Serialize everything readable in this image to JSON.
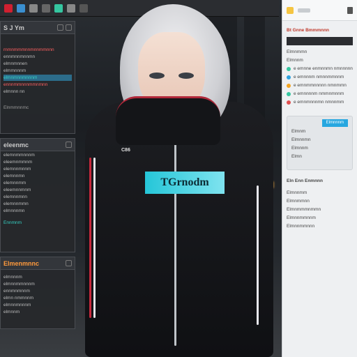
{
  "topbar": {
    "icons": [
      "app-icon",
      "file-icon",
      "edit-icon",
      "view-icon",
      "layer-icon",
      "brush-icon",
      "settings-icon"
    ]
  },
  "left_panels": {
    "p1": {
      "title": "S J Ym",
      "rows": [
        "rnmnmmmnnmnnmmnnn",
        "ennmnnmnnmn",
        "elmnmnnen",
        "elmmnnnm",
        "elmnmnnmnnnm",
        "ennnmmnnnmmnmnn",
        "elmnnn nn"
      ],
      "footer": "Elnmmnnmc"
    },
    "p2": {
      "title": "eleenmc",
      "rows": [
        "elemnmmnnnm",
        "eleemnmmnm",
        "elemnnmnnm",
        "elemnnmn",
        "elemnnmm",
        "eleemnnmnm",
        "elemnnmnn",
        "elemnnmmn",
        "elmnnnmn"
      ],
      "footer": "Ennmnm"
    },
    "p3": {
      "title": "Elmenmnnc",
      "rows": [
        "elmnnnm",
        "elmnnmmnnnm",
        "ennmnmnnm",
        "elmn nmmnnm",
        "elmnnmnnnm",
        "elmnnm"
      ]
    }
  },
  "right_panel": {
    "title": "Bt Gnne Bmmmnnn",
    "toolbar_icons": [
      "folder-icon",
      "pin-icon",
      "menu-icon"
    ],
    "section1": [
      "Elmnmmn",
      "Elmnnm",
      "e emnne enmnnmn nmnnnnn",
      "e emnnnm nmnnmmnnm",
      "e emnmmnnnnn nmnmmn",
      "e emnnnnm nmmnmnnm",
      "e emnmnnnmn nmnnmm"
    ],
    "dots": [
      "#35c6a0",
      "#2fa3e0",
      "#f5a623",
      "#35c6a0",
      "#e05050",
      "#f5a623"
    ],
    "section2_button": "Elmnnnm",
    "section2": [
      "Elmnm",
      "Elmnnmn",
      "Elmnnm",
      "Elmn"
    ],
    "section3": [
      "Eln Enn Enmnnn",
      "Elmnnmm",
      "Elmnmmnn",
      "Elmnmmmnmmn",
      "Elmnnmmnnm",
      "Elmnnmmnnn"
    ]
  },
  "figure": {
    "chest_text": "TGrnodm",
    "sleeve_text": "C86"
  },
  "colors": {
    "accent_red": "#c7283c",
    "accent_teal": "#25c6d8",
    "panel_dark": "#26282c",
    "panel_light": "#eef0f2"
  }
}
